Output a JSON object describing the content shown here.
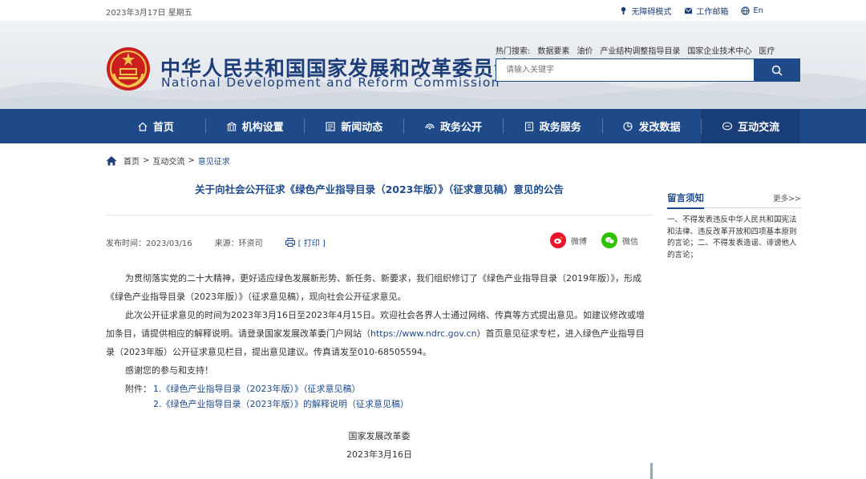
{
  "topbar": {
    "date": "2023年3月17日 星期五",
    "accessibility": "无障碍模式",
    "mailbox": "工作邮箱",
    "lang": "En"
  },
  "header": {
    "title_cn": "中华人民共和国国家发展和改革委员会",
    "title_en": "National Development and Reform Commission",
    "hot_label": "热门搜索:",
    "hot_items": [
      "数据要素",
      "油价",
      "产业结构调整指导目录",
      "国家企业技术中心",
      "医疗"
    ],
    "search_placeholder": "请输入关键字"
  },
  "nav": {
    "items": [
      {
        "label": "首页",
        "icon": "home-icon"
      },
      {
        "label": "机构设置",
        "icon": "building-icon"
      },
      {
        "label": "新闻动态",
        "icon": "news-icon"
      },
      {
        "label": "政务公开",
        "icon": "broadcast-icon"
      },
      {
        "label": "政务服务",
        "icon": "service-icon"
      },
      {
        "label": "发改数据",
        "icon": "pie-chart-icon"
      },
      {
        "label": "互动交流",
        "icon": "chat-icon"
      }
    ]
  },
  "breadcrumb": {
    "home": "首页",
    "sep": ">",
    "section": "互动交流",
    "current": "意见征求"
  },
  "article": {
    "title": "关于向社会公开征求《绿色产业指导目录（2023年版）》（征求意见稿）意见的公告",
    "publish_time": "发布时间：2023/03/16",
    "source": "来源：环资司",
    "print": "[ 打印 ]",
    "share_weibo": "微博",
    "share_wechat": "微信",
    "p1": "为贯彻落实党的二十大精神，更好适应绿色发展新形势、新任务、新要求，我们组织修订了《绿色产业指导目录（2019年版）》，形成《绿色产业指导目录（2023年版）》（征求意见稿），现向社会公开征求意见。",
    "p2_a": "此次公开征求意见的时间为2023年3月16日至2023年4月15日。欢迎社会各界人士通过网络、传真等方式提出意见。如建议修改或增加条目，请提供相应的解释说明。请登录国家发展改革委门户网站（",
    "p2_link": "https://www.ndrc.gov.cn",
    "p2_b": "）首页意见征求专栏，进入绿色产业指导目录（2023年版）公开征求意见栏目，提出意见建议。传真请发至010-68505594。",
    "p3": "感谢您的参与和支持！",
    "attach_label": "附件：",
    "attach_1": "1.《绿色产业指导目录（2023年版）》（征求意见稿）",
    "attach_2": "2.《绿色产业指导目录（2023年版）》的解释说明（征求意见稿）",
    "sign_org": "国家发展改革委",
    "sign_date": "2023年3月16日"
  },
  "sidebar": {
    "title": "留言须知",
    "more": "更多>>",
    "text": "一、不得发表违反中华人民共和国宪法和法律、违反改革开放和四项基本原则的言论；二、不得发表造谣、诽谤他人的言论；"
  },
  "colors": {
    "brand": "#1e4a8a",
    "nav_bg": "#1e4a8a",
    "weibo": "#e6162d",
    "wechat": "#2dc100"
  }
}
